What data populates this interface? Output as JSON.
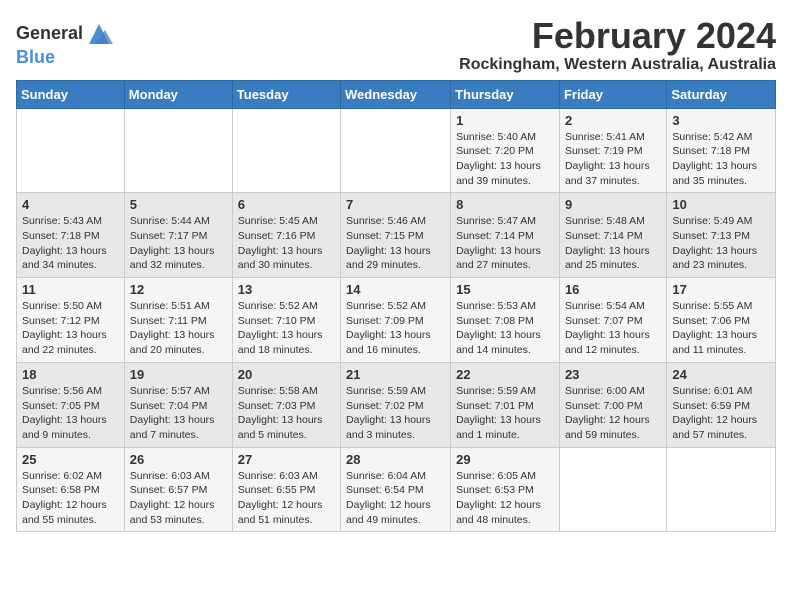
{
  "header": {
    "logo_line1": "General",
    "logo_line2": "Blue",
    "title": "February 2024",
    "subtitle": "Rockingham, Western Australia, Australia"
  },
  "calendar": {
    "days_of_week": [
      "Sunday",
      "Monday",
      "Tuesday",
      "Wednesday",
      "Thursday",
      "Friday",
      "Saturday"
    ],
    "weeks": [
      [
        {
          "day": "",
          "info": ""
        },
        {
          "day": "",
          "info": ""
        },
        {
          "day": "",
          "info": ""
        },
        {
          "day": "",
          "info": ""
        },
        {
          "day": "1",
          "info": "Sunrise: 5:40 AM\nSunset: 7:20 PM\nDaylight: 13 hours\nand 39 minutes."
        },
        {
          "day": "2",
          "info": "Sunrise: 5:41 AM\nSunset: 7:19 PM\nDaylight: 13 hours\nand 37 minutes."
        },
        {
          "day": "3",
          "info": "Sunrise: 5:42 AM\nSunset: 7:18 PM\nDaylight: 13 hours\nand 35 minutes."
        }
      ],
      [
        {
          "day": "4",
          "info": "Sunrise: 5:43 AM\nSunset: 7:18 PM\nDaylight: 13 hours\nand 34 minutes."
        },
        {
          "day": "5",
          "info": "Sunrise: 5:44 AM\nSunset: 7:17 PM\nDaylight: 13 hours\nand 32 minutes."
        },
        {
          "day": "6",
          "info": "Sunrise: 5:45 AM\nSunset: 7:16 PM\nDaylight: 13 hours\nand 30 minutes."
        },
        {
          "day": "7",
          "info": "Sunrise: 5:46 AM\nSunset: 7:15 PM\nDaylight: 13 hours\nand 29 minutes."
        },
        {
          "day": "8",
          "info": "Sunrise: 5:47 AM\nSunset: 7:14 PM\nDaylight: 13 hours\nand 27 minutes."
        },
        {
          "day": "9",
          "info": "Sunrise: 5:48 AM\nSunset: 7:14 PM\nDaylight: 13 hours\nand 25 minutes."
        },
        {
          "day": "10",
          "info": "Sunrise: 5:49 AM\nSunset: 7:13 PM\nDaylight: 13 hours\nand 23 minutes."
        }
      ],
      [
        {
          "day": "11",
          "info": "Sunrise: 5:50 AM\nSunset: 7:12 PM\nDaylight: 13 hours\nand 22 minutes."
        },
        {
          "day": "12",
          "info": "Sunrise: 5:51 AM\nSunset: 7:11 PM\nDaylight: 13 hours\nand 20 minutes."
        },
        {
          "day": "13",
          "info": "Sunrise: 5:52 AM\nSunset: 7:10 PM\nDaylight: 13 hours\nand 18 minutes."
        },
        {
          "day": "14",
          "info": "Sunrise: 5:52 AM\nSunset: 7:09 PM\nDaylight: 13 hours\nand 16 minutes."
        },
        {
          "day": "15",
          "info": "Sunrise: 5:53 AM\nSunset: 7:08 PM\nDaylight: 13 hours\nand 14 minutes."
        },
        {
          "day": "16",
          "info": "Sunrise: 5:54 AM\nSunset: 7:07 PM\nDaylight: 13 hours\nand 12 minutes."
        },
        {
          "day": "17",
          "info": "Sunrise: 5:55 AM\nSunset: 7:06 PM\nDaylight: 13 hours\nand 11 minutes."
        }
      ],
      [
        {
          "day": "18",
          "info": "Sunrise: 5:56 AM\nSunset: 7:05 PM\nDaylight: 13 hours\nand 9 minutes."
        },
        {
          "day": "19",
          "info": "Sunrise: 5:57 AM\nSunset: 7:04 PM\nDaylight: 13 hours\nand 7 minutes."
        },
        {
          "day": "20",
          "info": "Sunrise: 5:58 AM\nSunset: 7:03 PM\nDaylight: 13 hours\nand 5 minutes."
        },
        {
          "day": "21",
          "info": "Sunrise: 5:59 AM\nSunset: 7:02 PM\nDaylight: 13 hours\nand 3 minutes."
        },
        {
          "day": "22",
          "info": "Sunrise: 5:59 AM\nSunset: 7:01 PM\nDaylight: 13 hours\nand 1 minute."
        },
        {
          "day": "23",
          "info": "Sunrise: 6:00 AM\nSunset: 7:00 PM\nDaylight: 12 hours\nand 59 minutes."
        },
        {
          "day": "24",
          "info": "Sunrise: 6:01 AM\nSunset: 6:59 PM\nDaylight: 12 hours\nand 57 minutes."
        }
      ],
      [
        {
          "day": "25",
          "info": "Sunrise: 6:02 AM\nSunset: 6:58 PM\nDaylight: 12 hours\nand 55 minutes."
        },
        {
          "day": "26",
          "info": "Sunrise: 6:03 AM\nSunset: 6:57 PM\nDaylight: 12 hours\nand 53 minutes."
        },
        {
          "day": "27",
          "info": "Sunrise: 6:03 AM\nSunset: 6:55 PM\nDaylight: 12 hours\nand 51 minutes."
        },
        {
          "day": "28",
          "info": "Sunrise: 6:04 AM\nSunset: 6:54 PM\nDaylight: 12 hours\nand 49 minutes."
        },
        {
          "day": "29",
          "info": "Sunrise: 6:05 AM\nSunset: 6:53 PM\nDaylight: 12 hours\nand 48 minutes."
        },
        {
          "day": "",
          "info": ""
        },
        {
          "day": "",
          "info": ""
        }
      ]
    ]
  }
}
